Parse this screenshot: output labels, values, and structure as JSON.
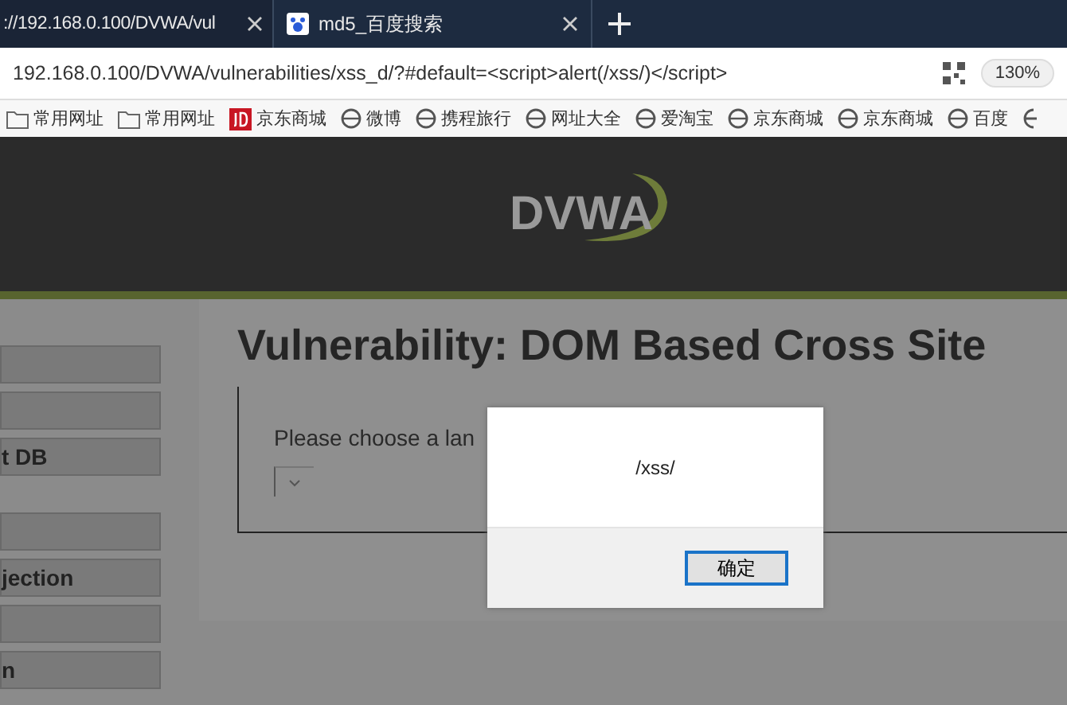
{
  "browser": {
    "tabs": [
      {
        "title": "://192.168.0.100/DVWA/vul",
        "selected": true
      },
      {
        "title": "md5_百度搜索",
        "selected": false
      }
    ],
    "address": "192.168.0.100/DVWA/vulnerabilities/xss_d/?#default=<script>alert(/xss/)</script>",
    "zoom": "130%",
    "bookmarks": [
      {
        "label": "常用网址",
        "kind": "folder"
      },
      {
        "label": "常用网址",
        "kind": "folder"
      },
      {
        "label": "京东商城",
        "kind": "jd"
      },
      {
        "label": "微博",
        "kind": "globe"
      },
      {
        "label": "携程旅行",
        "kind": "globe"
      },
      {
        "label": "网址大全",
        "kind": "globe"
      },
      {
        "label": "爱淘宝",
        "kind": "globe"
      },
      {
        "label": "京东商城",
        "kind": "globe"
      },
      {
        "label": "京东商城",
        "kind": "globe"
      },
      {
        "label": "百度",
        "kind": "globe"
      }
    ]
  },
  "page": {
    "logo": "DVWA",
    "menu": [
      {
        "group": [
          {
            "kind": "blank"
          },
          {
            "kind": "blank"
          },
          {
            "kind": "text",
            "label": "t DB"
          }
        ]
      },
      {
        "group": [
          {
            "kind": "blank"
          },
          {
            "kind": "text",
            "label": "jection"
          },
          {
            "kind": "blank"
          },
          {
            "kind": "text",
            "label": "n"
          }
        ]
      }
    ],
    "title": "Vulnerability: DOM Based Cross Site",
    "prompt": "Please choose a lan"
  },
  "alert": {
    "message": "/xss/",
    "button": "确定"
  }
}
